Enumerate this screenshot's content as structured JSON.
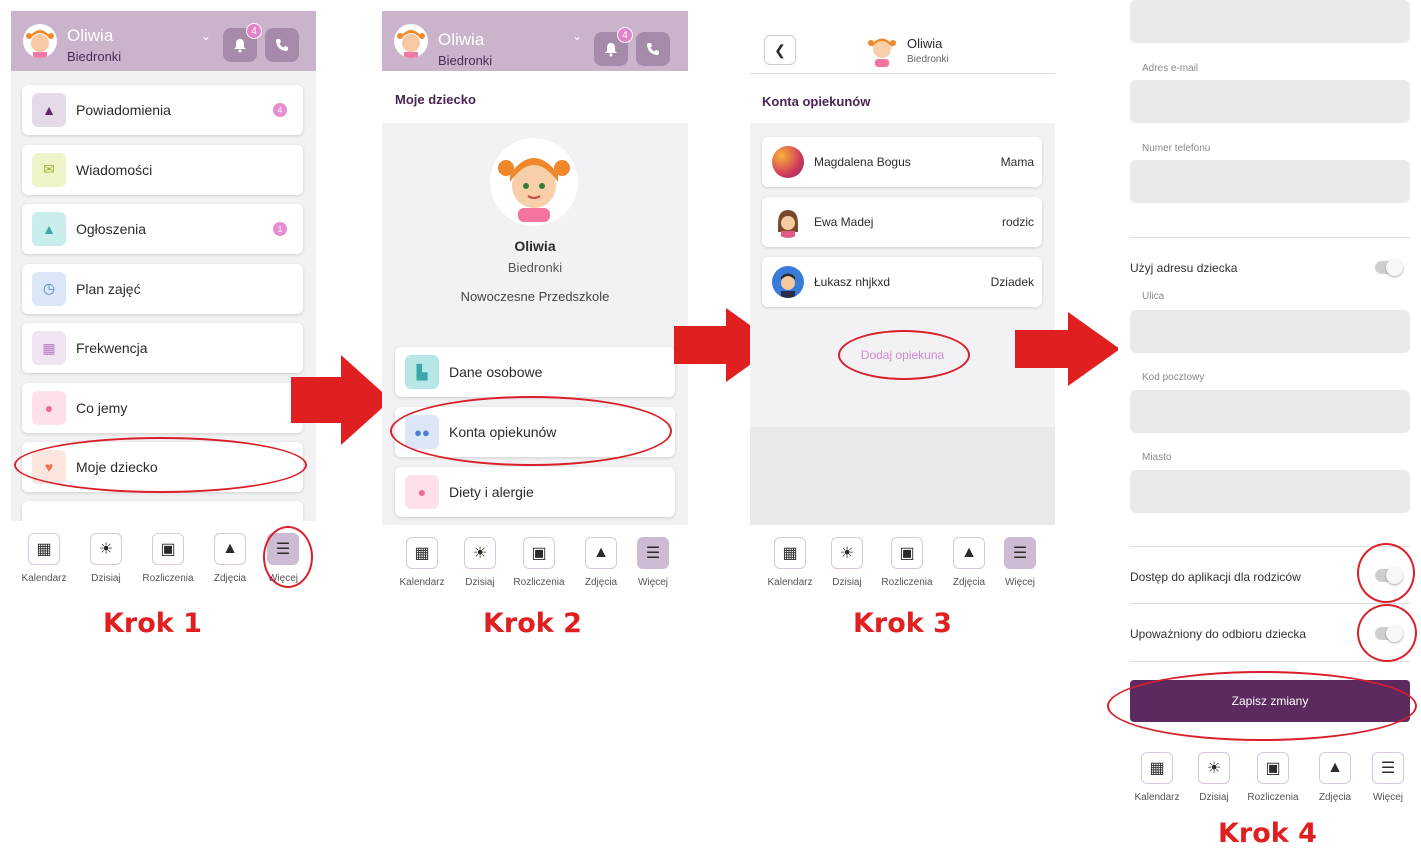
{
  "colors": {
    "header": "#c9b4cc",
    "accent": "#5c2a5e",
    "arrow": "#e02020",
    "ring": "#d9202a",
    "badge": "#e583c8"
  },
  "header": {
    "child_name": "Oliwia",
    "group": "Biedronki",
    "notif_count": "4"
  },
  "nav": [
    "Kalendarz",
    "Dzisiaj",
    "Rozliczenia",
    "Zdjęcia",
    "Więcej"
  ],
  "step1": {
    "menu": [
      {
        "label": "Powiadomienia",
        "icon": "bell-icon",
        "badge": "4"
      },
      {
        "label": "Wiadomości",
        "icon": "envelope-icon",
        "badge": ""
      },
      {
        "label": "Ogłoszenia",
        "icon": "warning-icon",
        "badge": "1"
      },
      {
        "label": "Plan zajęć",
        "icon": "clock-icon",
        "badge": ""
      },
      {
        "label": "Frekwencja",
        "icon": "calendar-icon",
        "badge": ""
      },
      {
        "label": "Co jemy",
        "icon": "apple-icon",
        "badge": ""
      },
      {
        "label": "Moje dziecko",
        "icon": "heart-icon",
        "badge": ""
      }
    ],
    "caption": "Krok 1"
  },
  "step2": {
    "title": "Moje dziecko",
    "child_name": "Oliwia",
    "group": "Biedronki",
    "school": "Nowoczesne Przedszkole",
    "menu": [
      {
        "label": "Dane osobowe",
        "icon": "id-card-icon"
      },
      {
        "label": "Konta opiekunów",
        "icon": "people-icon"
      },
      {
        "label": "Diety i alergie",
        "icon": "apple-icon"
      }
    ],
    "caption": "Krok 2"
  },
  "step3": {
    "top_name": "Oliwia",
    "top_group": "Biedronki",
    "title": "Konta opiekunów",
    "guardians": [
      {
        "name": "Magdalena Bogus",
        "role": "Mama"
      },
      {
        "name": "Ewa Madej",
        "role": "rodzic"
      },
      {
        "name": "Łukasz nhjkxd",
        "role": "Dziadek"
      }
    ],
    "add_link": "Dodaj opiekuna",
    "caption": "Krok 3"
  },
  "step4": {
    "email_label": "Adres e-mail",
    "phone_label": "Numer telefonu",
    "use_child_address": "Użyj adresu dziecka",
    "street_label": "Ulica",
    "postcode_label": "Kod pocztowy",
    "city_label": "Miasto",
    "app_access": "Dostęp do aplikacji dla rodziców",
    "pickup_auth": "Upoważniony do odbioru dziecka",
    "save": "Zapisz zmiany",
    "caption": "Krok 4"
  }
}
